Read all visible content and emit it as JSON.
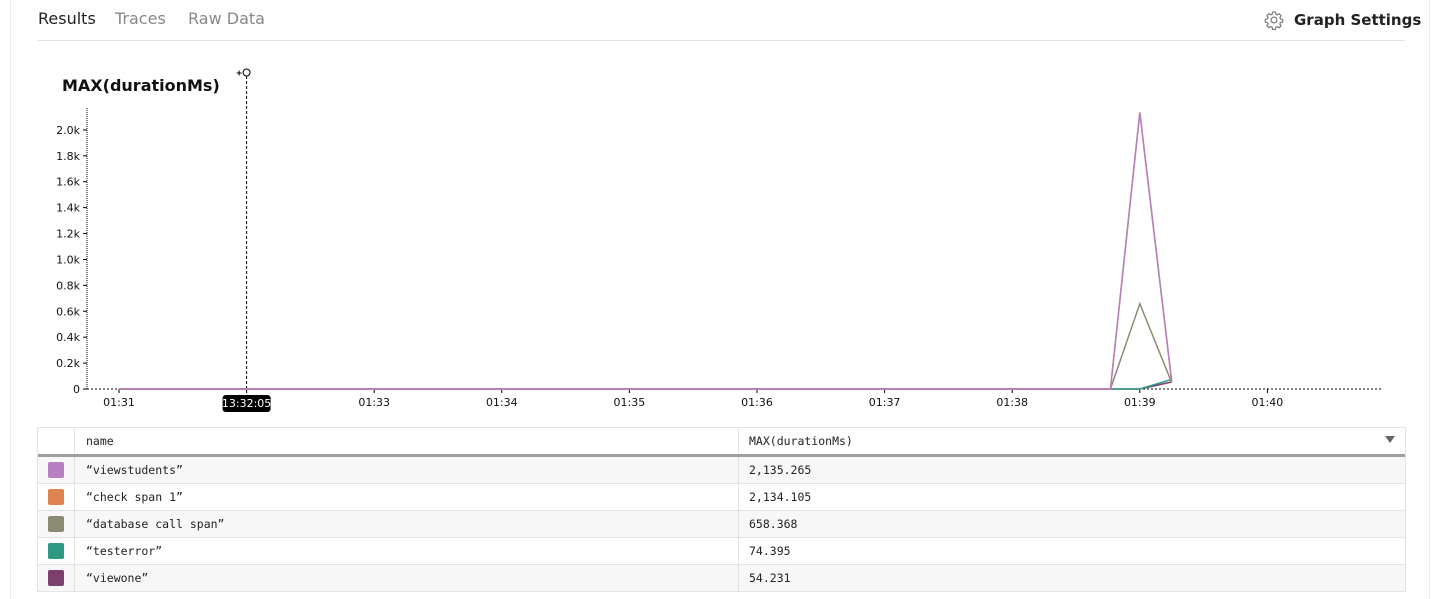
{
  "tabs": [
    {
      "label": "Results",
      "active": true
    },
    {
      "label": "Traces",
      "active": false
    },
    {
      "label": "Raw Data",
      "active": false
    }
  ],
  "graph_settings_label": "Graph Settings",
  "chart_data": {
    "type": "line",
    "title": "MAX(durationMs)",
    "y_ticks": [
      "0",
      "0.2k",
      "0.4k",
      "0.6k",
      "0.8k",
      "1.0k",
      "1.2k",
      "1.4k",
      "1.6k",
      "1.8k",
      "2.0k"
    ],
    "x_ticks": [
      "01:31",
      "13:32:05",
      "01:33",
      "01:34",
      "01:35",
      "01:36",
      "01:37",
      "01:38",
      "01:39",
      "01:40"
    ],
    "cursor_label": "13:32:05",
    "ylim": [
      0,
      2200
    ],
    "series": [
      {
        "name": "\"viewstudents\"",
        "color": "#b57fc1",
        "points": [
          [
            0,
            0
          ],
          [
            7.77,
            0
          ],
          [
            8.0,
            2135.265
          ],
          [
            8.25,
            60
          ]
        ]
      },
      {
        "name": "\"check span 1\"",
        "color": "#e0834e",
        "points": [
          [
            0,
            0
          ],
          [
            7.77,
            0
          ],
          [
            8.0,
            2134.105
          ],
          [
            8.25,
            55
          ]
        ]
      },
      {
        "name": "\"database call span\"",
        "color": "#8c8c72",
        "points": [
          [
            0,
            0
          ],
          [
            7.77,
            0
          ],
          [
            8.0,
            658.368
          ],
          [
            8.25,
            50
          ]
        ]
      },
      {
        "name": "\"testerror\"",
        "color": "#2e9a84",
        "points": [
          [
            0,
            0
          ],
          [
            8.0,
            0
          ],
          [
            8.25,
            74.395
          ]
        ]
      },
      {
        "name": "\"viewone\"",
        "color": "#7c3f6e",
        "points": [
          [
            0,
            0
          ],
          [
            8.0,
            0
          ],
          [
            8.25,
            54.231
          ]
        ]
      }
    ]
  },
  "table": {
    "headers": [
      "name",
      "MAX(durationMs)"
    ],
    "rows": [
      {
        "name": "“viewstudents”",
        "value": "2,135.265",
        "color": "#b57fc1"
      },
      {
        "name": "“check span 1”",
        "value": "2,134.105",
        "color": "#e0834e"
      },
      {
        "name": "“database call span”",
        "value": "658.368",
        "color": "#8c8c72"
      },
      {
        "name": "“testerror”",
        "value": "74.395",
        "color": "#2e9a84"
      },
      {
        "name": "“viewone”",
        "value": "54.231",
        "color": "#7c3f6e"
      }
    ]
  }
}
